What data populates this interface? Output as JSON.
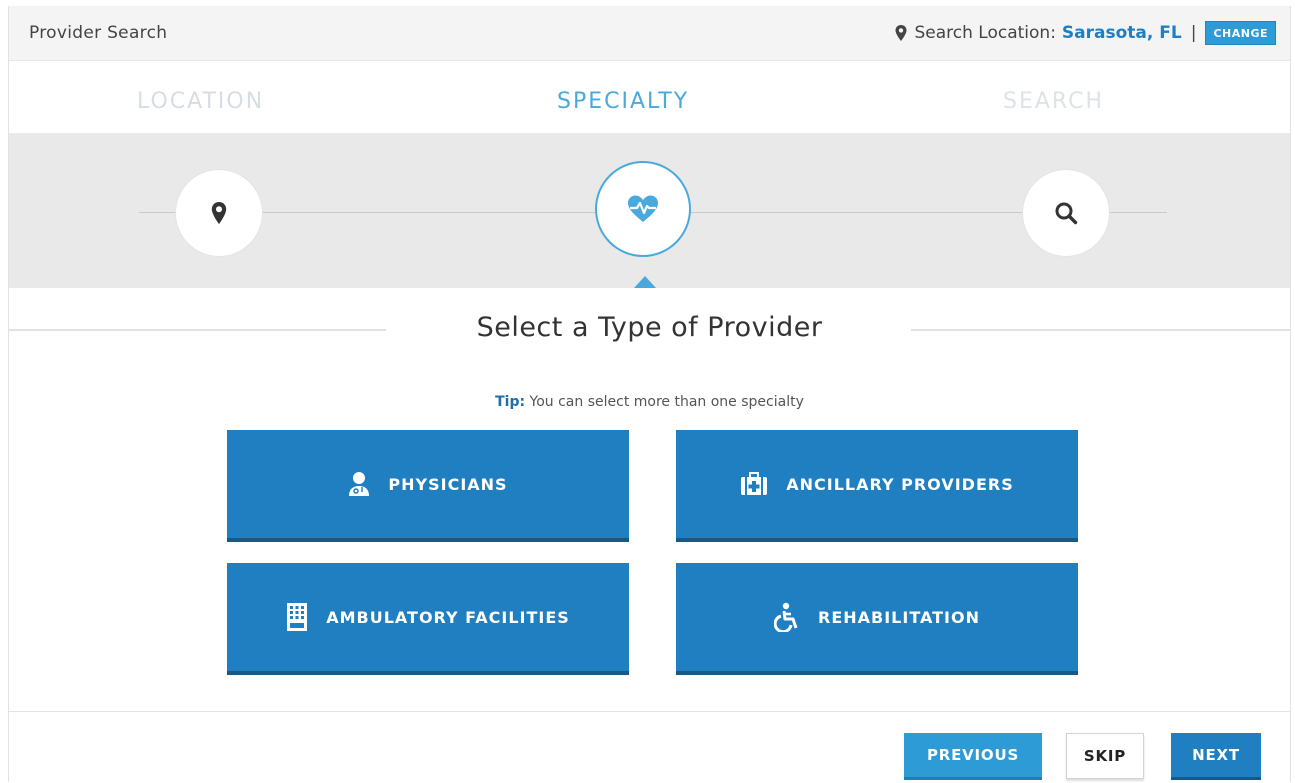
{
  "header": {
    "title": "Provider Search",
    "location_label": "Search Location:",
    "location_value": "Sarasota, FL",
    "separator": "|",
    "change_label": "CHANGE"
  },
  "steps": {
    "items": [
      {
        "label": "LOCATION",
        "icon": "location-pin-icon"
      },
      {
        "label": "SPECIALTY",
        "icon": "heartbeat-icon"
      },
      {
        "label": "SEARCH",
        "icon": "search-icon"
      }
    ],
    "active": "SPECIALTY"
  },
  "main": {
    "title": "Select a Type of Provider",
    "tip_label": "Tip:",
    "tip_text": " You can select more than one specialty",
    "tiles": [
      {
        "label": "PHYSICIANS",
        "icon": "doctor-icon"
      },
      {
        "label": "ANCILLARY PROVIDERS",
        "icon": "medical-kit-icon"
      },
      {
        "label": "AMBULATORY FACILITIES",
        "icon": "building-icon"
      },
      {
        "label": "REHABILITATION",
        "icon": "wheelchair-icon"
      }
    ]
  },
  "footer": {
    "previous_label": "PREVIOUS",
    "skip_label": "SKIP",
    "next_label": "NEXT"
  },
  "colors": {
    "accent": "#2c9bd6",
    "primary": "#1f7fc0",
    "link": "#1d7fc4"
  }
}
